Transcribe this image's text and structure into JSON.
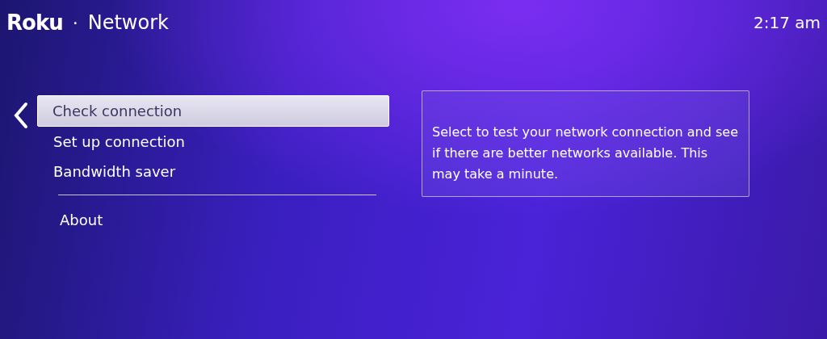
{
  "header": {
    "logo": "Roku",
    "separator": "·",
    "title": "Network",
    "time": "2:17 am"
  },
  "menu_groups": [
    {
      "items": [
        {
          "label": "Check connection",
          "selected": true
        },
        {
          "label": "Set up connection",
          "selected": false
        },
        {
          "label": "Bandwidth saver",
          "selected": false
        }
      ]
    },
    {
      "items": [
        {
          "label": "About",
          "selected": false
        }
      ]
    }
  ],
  "description": "Select to test your network connection and see if there are better networks available. This may take a minute."
}
